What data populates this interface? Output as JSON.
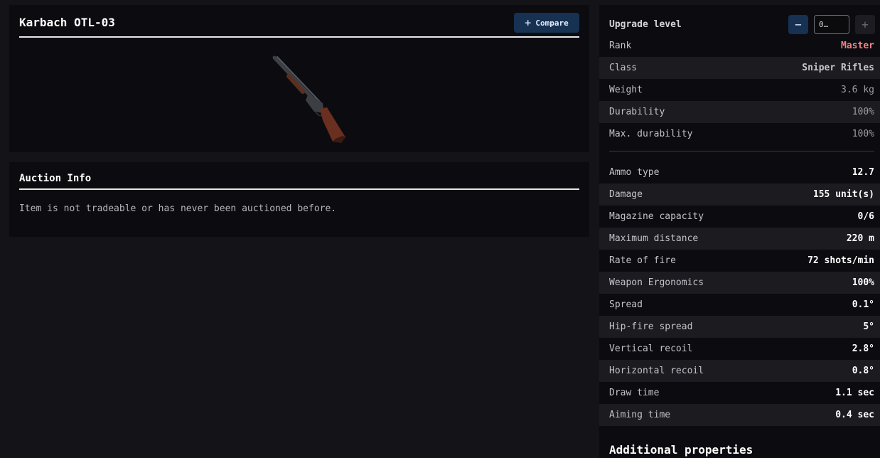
{
  "item": {
    "title": "Karbach OTL-03",
    "compare_label": "Compare"
  },
  "auction": {
    "title": "Auction Info",
    "message": "Item is not tradeable or has never been auctioned before."
  },
  "upgrade": {
    "label": "Upgrade level",
    "value": "0…"
  },
  "basic_stats": [
    {
      "name": "Rank",
      "value": "Master"
    },
    {
      "name": "Class",
      "value": "Sniper Rifles"
    },
    {
      "name": "Weight",
      "value": "3.6 kg"
    },
    {
      "name": "Durability",
      "value": "100%"
    },
    {
      "name": "Max. durability",
      "value": "100%"
    }
  ],
  "weapon_stats": [
    {
      "name": "Ammo type",
      "value": "12.7"
    },
    {
      "name": "Damage",
      "value": "155 unit(s)"
    },
    {
      "name": "Magazine capacity",
      "value": "0/6"
    },
    {
      "name": "Maximum distance",
      "value": "220 m"
    },
    {
      "name": "Rate of fire",
      "value": "72 shots/min"
    },
    {
      "name": "Weapon Ergonomics",
      "value": "100%"
    },
    {
      "name": "Spread",
      "value": "0.1°"
    },
    {
      "name": "Hip-fire spread",
      "value": "5°"
    },
    {
      "name": "Vertical recoil",
      "value": "2.8°"
    },
    {
      "name": "Horizontal recoil",
      "value": "0.8°"
    },
    {
      "name": "Draw time",
      "value": "1.1 sec"
    },
    {
      "name": "Aiming time",
      "value": "0.4 sec"
    }
  ],
  "additional": {
    "title": "Additional properties"
  },
  "colors": {
    "accent_button": "#163152",
    "rank_color": "#f08482",
    "background": "#131318",
    "card": "#0c0c10"
  }
}
